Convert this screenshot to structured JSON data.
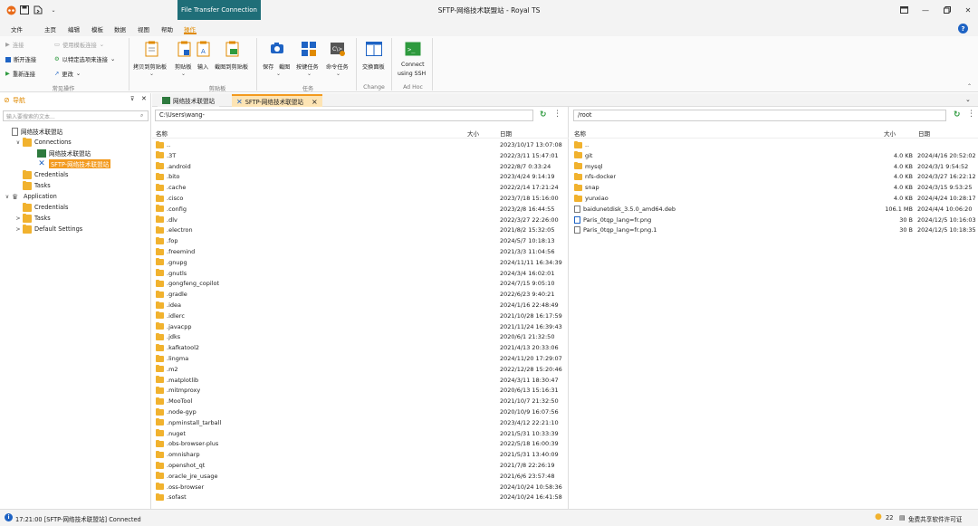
{
  "window": {
    "title": "SFTP-网络技术联盟站 - Royal TS",
    "context_tab": "File Transfer Connection"
  },
  "menu": {
    "items": [
      "文件",
      "主页",
      "编辑",
      "模板",
      "数据",
      "视图",
      "帮助",
      "操作"
    ],
    "active": "操作",
    "help": "?"
  },
  "ribbon": {
    "common": {
      "connect": "连接",
      "use_template_connect": "使用模板连接",
      "disconnect": "断开连接",
      "connect_with_options": "以特定选项来连接",
      "reconnect": "重新连接",
      "change": "更改",
      "label": "常见操作"
    },
    "clipboard": {
      "copy": "拷贝到剪贴板",
      "clipboard": "剪贴板",
      "input": "输入",
      "screenshot": "截图到剪贴板",
      "label": "剪贴板"
    },
    "tasks": {
      "save": "保存",
      "screenshot": "截图",
      "key_tasks": "按键任务",
      "commands": "命令任务",
      "label": "任务"
    },
    "change": {
      "swap": "交换面板",
      "label": "Change"
    },
    "adhoc": {
      "connect_ssh_1": "Connect",
      "connect_ssh_2": "using SSH",
      "label": "Ad Hoc"
    }
  },
  "nav": {
    "title": "导航",
    "filter_placeholder": "输入要搜索的文本...",
    "tree": [
      {
        "label": "网络技术联盟站",
        "level": 0,
        "toggle": "",
        "icon": "doc"
      },
      {
        "label": "Connections",
        "level": 1,
        "toggle": "∨",
        "icon": "folder"
      },
      {
        "label": "网络技术联盟站",
        "level": 2,
        "toggle": "",
        "icon": "terminal"
      },
      {
        "label": "SFTP-网络技术联盟站",
        "level": 2,
        "toggle": "",
        "icon": "sftp",
        "selected": true
      },
      {
        "label": "Credentials",
        "level": 1,
        "toggle": "",
        "icon": "folder"
      },
      {
        "label": "Tasks",
        "level": 1,
        "toggle": "",
        "icon": "folder"
      },
      {
        "label": "Application",
        "level": 0,
        "toggle": "∨",
        "icon": "app"
      },
      {
        "label": "Credentials",
        "level": 1,
        "toggle": "",
        "icon": "folder"
      },
      {
        "label": "Tasks",
        "level": 1,
        "toggle": ">",
        "icon": "folder"
      },
      {
        "label": "Default Settings",
        "level": 1,
        "toggle": ">",
        "icon": "folder"
      }
    ]
  },
  "tabs": [
    {
      "label": "网络技术联盟站",
      "active": false,
      "close": ""
    },
    {
      "label": "SFTP-网络技术联盟站",
      "active": true,
      "close": "×"
    }
  ],
  "local": {
    "path": "C:\\Users\\wang-",
    "headers": {
      "name": "名称",
      "size": "大小",
      "date": "日期"
    },
    "files": [
      {
        "name": "..",
        "size": "",
        "date": "2023/10/17 13:07:08"
      },
      {
        "name": ".3T",
        "size": "",
        "date": "2022/3/11 15:47:01"
      },
      {
        "name": ".android",
        "size": "",
        "date": "2022/8/7 0:33:24"
      },
      {
        "name": ".bito",
        "size": "",
        "date": "2023/4/24 9:14:19"
      },
      {
        "name": ".cache",
        "size": "",
        "date": "2022/2/14 17:21:24"
      },
      {
        "name": ".cisco",
        "size": "",
        "date": "2023/7/18 15:16:00"
      },
      {
        "name": ".config",
        "size": "",
        "date": "2023/2/8 16:44:55"
      },
      {
        "name": ".dlv",
        "size": "",
        "date": "2022/3/27 22:26:00"
      },
      {
        "name": ".electron",
        "size": "",
        "date": "2021/8/2 15:32:05"
      },
      {
        "name": ".fop",
        "size": "",
        "date": "2024/5/7 10:18:13"
      },
      {
        "name": ".freemind",
        "size": "",
        "date": "2021/3/3 11:04:56"
      },
      {
        "name": ".gnupg",
        "size": "",
        "date": "2024/11/11 16:34:39"
      },
      {
        "name": ".gnutls",
        "size": "",
        "date": "2024/3/4 16:02:01"
      },
      {
        "name": ".gongfeng_copilot",
        "size": "",
        "date": "2024/7/15 9:05:10"
      },
      {
        "name": ".gradle",
        "size": "",
        "date": "2022/6/23 9:40:21"
      },
      {
        "name": ".idea",
        "size": "",
        "date": "2024/1/16 22:48:49"
      },
      {
        "name": ".idlerc",
        "size": "",
        "date": "2021/10/28 16:17:59"
      },
      {
        "name": ".javacpp",
        "size": "",
        "date": "2021/11/24 16:39:43"
      },
      {
        "name": ".jdks",
        "size": "",
        "date": "2020/6/1 21:32:50"
      },
      {
        "name": ".kafkatool2",
        "size": "",
        "date": "2021/4/13 20:33:06"
      },
      {
        "name": ".lingma",
        "size": "",
        "date": "2024/11/20 17:29:07"
      },
      {
        "name": ".m2",
        "size": "",
        "date": "2022/12/28 15:20:46"
      },
      {
        "name": ".matplotlib",
        "size": "",
        "date": "2024/3/11 18:30:47"
      },
      {
        "name": ".mitmproxy",
        "size": "",
        "date": "2020/6/13 15:16:31"
      },
      {
        "name": ".MooTool",
        "size": "",
        "date": "2021/10/7 21:32:50"
      },
      {
        "name": ".node-gyp",
        "size": "",
        "date": "2020/10/9 16:07:56"
      },
      {
        "name": ".npminstall_tarball",
        "size": "",
        "date": "2023/4/12 22:21:10"
      },
      {
        "name": ".nuget",
        "size": "",
        "date": "2021/5/31 10:33:39"
      },
      {
        "name": ".obs-browser-plus",
        "size": "",
        "date": "2022/5/18 16:00:39"
      },
      {
        "name": ".omnisharp",
        "size": "",
        "date": "2021/5/31 13:40:09"
      },
      {
        "name": ".openshot_qt",
        "size": "",
        "date": "2021/7/8 22:26:19"
      },
      {
        "name": ".oracle_jre_usage",
        "size": "",
        "date": "2021/6/6 23:57:48"
      },
      {
        "name": ".oss-browser",
        "size": "",
        "date": "2024/10/24 10:58:36"
      },
      {
        "name": ".sofast",
        "size": "",
        "date": "2024/10/24 16:41:58"
      }
    ]
  },
  "remote": {
    "path": "/root",
    "headers": {
      "name": "名称",
      "size": "大小",
      "date": "日期"
    },
    "files": [
      {
        "name": "..",
        "size": "",
        "date": "",
        "type": "folder"
      },
      {
        "name": "git",
        "size": "4.0 KB",
        "date": "2024/4/16 20:52:02",
        "type": "folder"
      },
      {
        "name": "mysql",
        "size": "4.0 KB",
        "date": "2024/3/1 9:54:52",
        "type": "folder"
      },
      {
        "name": "nfs-docker",
        "size": "4.0 KB",
        "date": "2024/3/27 16:22:12",
        "type": "folder"
      },
      {
        "name": "snap",
        "size": "4.0 KB",
        "date": "2024/3/15 9:53:25",
        "type": "folder"
      },
      {
        "name": "yunxiao",
        "size": "4.0 KB",
        "date": "2024/4/24 10:28:17",
        "type": "folder"
      },
      {
        "name": "baidunetdisk_3.5.0_amd64.deb",
        "size": "106.1 MB",
        "date": "2024/4/4 10:06:20",
        "type": "file"
      },
      {
        "name": "Paris_0tqp_lang=fr.png",
        "size": "30 B",
        "date": "2024/12/5 10:16:03",
        "type": "image"
      },
      {
        "name": "Paris_0tqp_lang=fr.png.1",
        "size": "30 B",
        "date": "2024/12/5 10:18:35",
        "type": "file"
      }
    ]
  },
  "status": {
    "text": "17:21:00 [SFTP-网络技术联盟站] Connected",
    "count": "22",
    "license": "免费共享软件许可证"
  },
  "colors": {
    "accent": "#e08a00",
    "context_tab": "#1f6e78",
    "selected": "#f39a1e",
    "folder": "#f1b22e",
    "refresh": "#2e9a3e"
  }
}
